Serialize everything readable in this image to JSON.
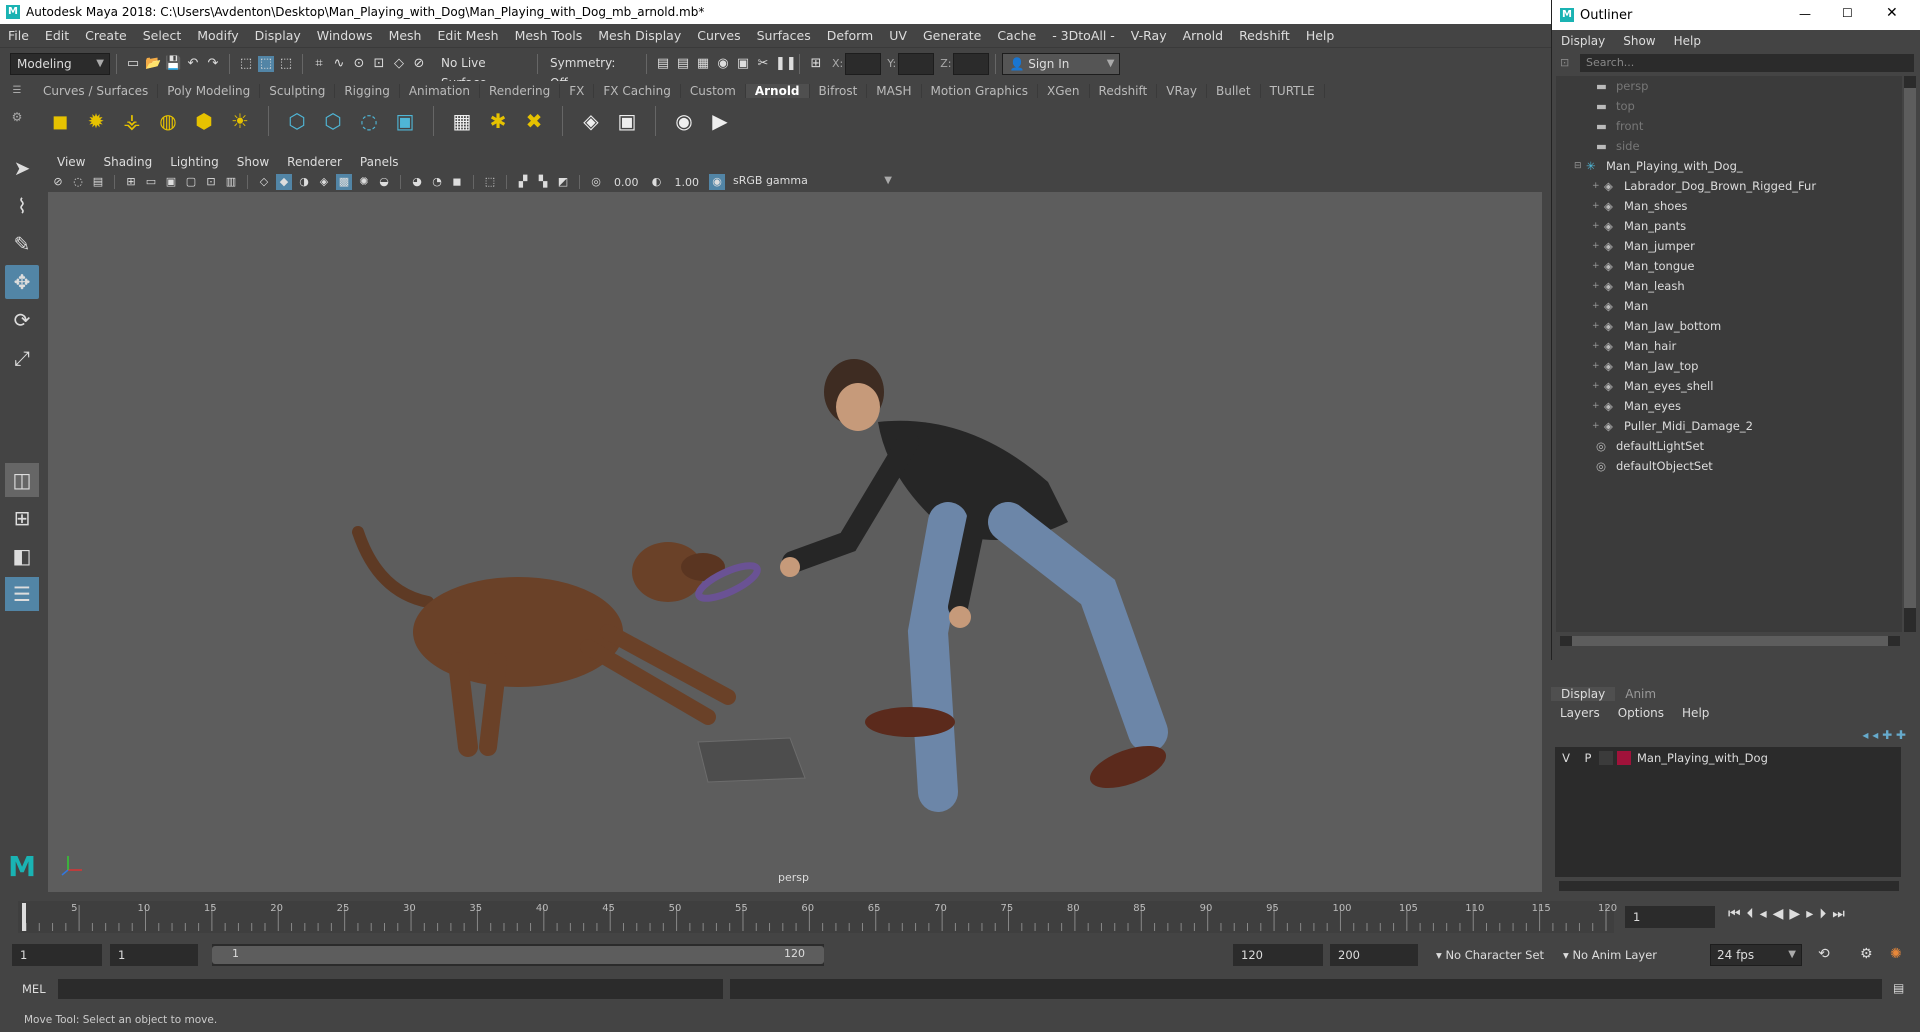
{
  "window": {
    "title": "Autodesk Maya 2018: C:\\Users\\Avdenton\\Desktop\\Man_Playing_with_Dog\\Man_Playing_with_Dog_mb_arnold.mb*"
  },
  "menus": [
    "File",
    "Edit",
    "Create",
    "Select",
    "Modify",
    "Display",
    "Windows",
    "Mesh",
    "Edit Mesh",
    "Mesh Tools",
    "Mesh Display",
    "Curves",
    "Surfaces",
    "Deform",
    "UV",
    "Generate",
    "Cache",
    "- 3DtoAll -",
    "V-Ray",
    "Arnold",
    "Redshift",
    "Help"
  ],
  "statusline": {
    "workspace": "Modeling",
    "live_surface": "No Live Surface",
    "symmetry": "Symmetry: Off",
    "x_label": "X:",
    "y_label": "Y:",
    "z_label": "Z:",
    "sign_in": "Sign In"
  },
  "shelf_tabs": [
    "Curves / Surfaces",
    "Poly Modeling",
    "Sculpting",
    "Rigging",
    "Animation",
    "Rendering",
    "FX",
    "FX Caching",
    "Custom",
    "Arnold",
    "Bifrost",
    "MASH",
    "Motion Graphics",
    "XGen",
    "Redshift",
    "VRay",
    "Bullet",
    "TURTLE"
  ],
  "active_shelf": "Arnold",
  "panel_menu": [
    "View",
    "Shading",
    "Lighting",
    "Show",
    "Renderer",
    "Panels"
  ],
  "panel_toolbar": {
    "exposure": "0.00",
    "gamma": "1.00",
    "color_space": "sRGB gamma"
  },
  "viewport": {
    "camera_label": "persp"
  },
  "outliner": {
    "title": "Outliner",
    "menu": [
      "Display",
      "Show",
      "Help"
    ],
    "search_placeholder": "Search...",
    "items": [
      {
        "label": "persp",
        "type": "camera",
        "indent": 0,
        "dim": true
      },
      {
        "label": "top",
        "type": "camera",
        "indent": 0,
        "dim": true
      },
      {
        "label": "front",
        "type": "camera",
        "indent": 0,
        "dim": true
      },
      {
        "label": "side",
        "type": "camera",
        "indent": 0,
        "dim": true
      },
      {
        "label": "Man_Playing_with_Dog_",
        "type": "group",
        "indent": 0,
        "dim": false
      },
      {
        "label": "Labrador_Dog_Brown_Rigged_Fur",
        "type": "mesh",
        "indent": 1,
        "dim": false
      },
      {
        "label": "Man_shoes",
        "type": "mesh",
        "indent": 1,
        "dim": false
      },
      {
        "label": "Man_pants",
        "type": "mesh",
        "indent": 1,
        "dim": false
      },
      {
        "label": "Man_jumper",
        "type": "mesh",
        "indent": 1,
        "dim": false
      },
      {
        "label": "Man_tongue",
        "type": "mesh",
        "indent": 1,
        "dim": false
      },
      {
        "label": "Man_leash",
        "type": "mesh",
        "indent": 1,
        "dim": false
      },
      {
        "label": "Man",
        "type": "mesh",
        "indent": 1,
        "dim": false
      },
      {
        "label": "Man_Jaw_bottom",
        "type": "mesh",
        "indent": 1,
        "dim": false
      },
      {
        "label": "Man_hair",
        "type": "mesh",
        "indent": 1,
        "dim": false
      },
      {
        "label": "Man_Jaw_top",
        "type": "mesh",
        "indent": 1,
        "dim": false
      },
      {
        "label": "Man_eyes_shell",
        "type": "mesh",
        "indent": 1,
        "dim": false
      },
      {
        "label": "Man_eyes",
        "type": "mesh",
        "indent": 1,
        "dim": false
      },
      {
        "label": "Puller_Midi_Damage_2",
        "type": "mesh",
        "indent": 1,
        "dim": false
      },
      {
        "label": "defaultLightSet",
        "type": "set",
        "indent": 0,
        "dim": false
      },
      {
        "label": "defaultObjectSet",
        "type": "set",
        "indent": 0,
        "dim": false
      }
    ]
  },
  "layer_editor": {
    "tabs": [
      "Display",
      "Anim"
    ],
    "menu": [
      "Layers",
      "Options",
      "Help"
    ],
    "layer": {
      "v": "V",
      "p": "P",
      "name": "Man_Playing_with_Dog",
      "color": "#a0123a"
    }
  },
  "timeline": {
    "ticks": [
      "5",
      "10",
      "15",
      "20",
      "25",
      "30",
      "35",
      "40",
      "45",
      "50",
      "55",
      "60",
      "65",
      "70",
      "75",
      "80",
      "85",
      "90",
      "95",
      "100",
      "105",
      "110",
      "115",
      "120"
    ],
    "current_frame": "1"
  },
  "range": {
    "start": "1",
    "playback_start": "1",
    "slider_start": "1",
    "slider_end": "120",
    "playback_end": "120",
    "end": "200",
    "character_set": "No Character Set",
    "anim_layer": "No Anim Layer",
    "fps": "24 fps"
  },
  "command": {
    "mel_label": "MEL"
  },
  "help_line": "Move Tool: Select an object to move."
}
